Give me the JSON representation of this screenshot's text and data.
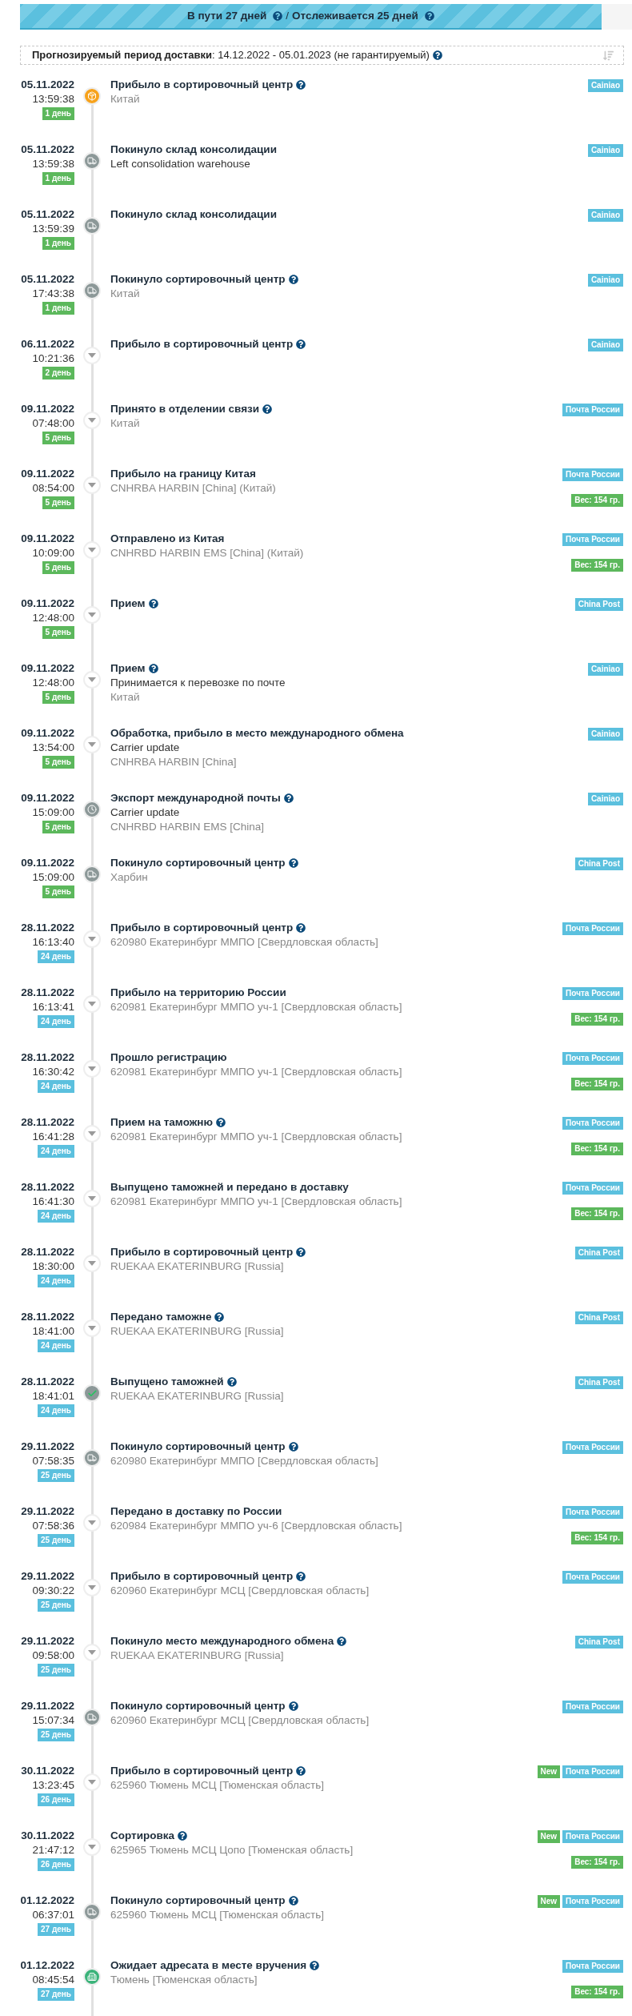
{
  "progress": {
    "level": 0.95,
    "in_transit": "В пути 27 дней",
    "separator": "/",
    "tracked": "Отслеживается 25 дней"
  },
  "forecast": {
    "text": "**Прогнозируемый период доставки**: 14.12.2022 - 05.01.2023 (не гарантируемый)"
  },
  "events": [
    {
      "date": "05.11.2022",
      "time": "13:59:38",
      "days": {
        "text": "1 день",
        "color": "#5cb85c"
      },
      "kind": "box",
      "title": "Прибыло в сортировочный центр",
      "help": true,
      "lines": [
        {
          "text": "Китай",
          "kind": "place"
        }
      ],
      "tags": [
        {
          "text": "Cainiao",
          "color": "#5bc0de"
        }
      ]
    },
    {
      "date": "05.11.2022",
      "time": "13:59:38",
      "days": {
        "text": "1 день",
        "color": "#5cb85c"
      },
      "kind": "truck",
      "title": "Покинуло склад консолидации",
      "help": false,
      "lines": [
        {
          "text": "Left consolidation warehouse",
          "kind": "note"
        }
      ],
      "tags": [
        {
          "text": "Cainiao",
          "color": "#5bc0de"
        }
      ]
    },
    {
      "date": "05.11.2022",
      "time": "13:59:39",
      "days": {
        "text": "1 день",
        "color": "#5cb85c"
      },
      "kind": "truck",
      "title": "Покинуло склад консолидации",
      "help": false,
      "tags": [
        {
          "text": "Cainiao",
          "color": "#5bc0de"
        }
      ]
    },
    {
      "date": "05.11.2022",
      "time": "17:43:38",
      "days": {
        "text": "1 день",
        "color": "#5cb85c"
      },
      "kind": "truck",
      "title": "Покинуло сортировочный центр",
      "help": true,
      "lines": [
        {
          "text": "Китай",
          "kind": "place"
        }
      ],
      "tags": [
        {
          "text": "Cainiao",
          "color": "#5bc0de"
        }
      ]
    },
    {
      "date": "06.11.2022",
      "time": "10:21:36",
      "days": {
        "text": "2 день",
        "color": "#5cb85c"
      },
      "kind": "arrow",
      "title": "Прибыло в сортировочный центр",
      "help": true,
      "tags": [
        {
          "text": "Cainiao",
          "color": "#5bc0de"
        }
      ]
    },
    {
      "date": "09.11.2022",
      "time": "07:48:00",
      "days": {
        "text": "5 день",
        "color": "#5cb85c"
      },
      "kind": "arrow",
      "title": "Принято в отделении связи",
      "help": true,
      "lines": [
        {
          "text": "Китай",
          "kind": "place"
        }
      ],
      "tags": [
        {
          "text": "Почта России",
          "color": "#5bc0de"
        }
      ]
    },
    {
      "date": "09.11.2022",
      "time": "08:54:00",
      "days": {
        "text": "5 день",
        "color": "#5cb85c"
      },
      "kind": "arrow",
      "title": "Прибыло на границу Китая",
      "help": false,
      "lines": [
        {
          "text": "CNHRBA HARBIN [China] (Китай)",
          "kind": "place"
        }
      ],
      "tags": [
        {
          "text": "Почта России",
          "color": "#5bc0de"
        }
      ],
      "weight": "Вес: 154 гр."
    },
    {
      "date": "09.11.2022",
      "time": "10:09:00",
      "days": {
        "text": "5 день",
        "color": "#5cb85c"
      },
      "kind": "arrow",
      "title": "Отправлено из Китая",
      "help": false,
      "lines": [
        {
          "text": "CNHRBD HARBIN EMS [China] (Китай)",
          "kind": "place"
        }
      ],
      "tags": [
        {
          "text": "Почта России",
          "color": "#5bc0de"
        }
      ],
      "weight": "Вес: 154 гр."
    },
    {
      "date": "09.11.2022",
      "time": "12:48:00",
      "days": {
        "text": "5 день",
        "color": "#5cb85c"
      },
      "kind": "arrow",
      "title": "Прием",
      "help": true,
      "tags": [
        {
          "text": "China Post",
          "color": "#5bc0de"
        }
      ]
    },
    {
      "date": "09.11.2022",
      "time": "12:48:00",
      "days": {
        "text": "5 день",
        "color": "#5cb85c"
      },
      "kind": "arrow",
      "title": "Прием",
      "help": true,
      "lines": [
        {
          "text": "Принимается к перевозке по почте",
          "kind": "note"
        },
        {
          "text": "Китай",
          "kind": "place"
        }
      ],
      "tags": [
        {
          "text": "Cainiao",
          "color": "#5bc0de"
        }
      ]
    },
    {
      "date": "09.11.2022",
      "time": "13:54:00",
      "days": {
        "text": "5 день",
        "color": "#5cb85c"
      },
      "kind": "arrow",
      "title": "Обработка, прибыло в место международного обмена",
      "help": false,
      "lines": [
        {
          "text": "Carrier update",
          "kind": "note"
        },
        {
          "text": "CNHRBA HARBIN [China]",
          "kind": "place"
        }
      ],
      "tags": [
        {
          "text": "Cainiao",
          "color": "#5bc0de"
        }
      ]
    },
    {
      "date": "09.11.2022",
      "time": "15:09:00",
      "days": {
        "text": "5 день",
        "color": "#5cb85c"
      },
      "kind": "clock",
      "title": "Экспорт международной почты",
      "help": true,
      "lines": [
        {
          "text": "Carrier update",
          "kind": "note"
        },
        {
          "text": "CNHRBD HARBIN EMS [China]",
          "kind": "place"
        }
      ],
      "tags": [
        {
          "text": "Cainiao",
          "color": "#5bc0de"
        }
      ]
    },
    {
      "date": "09.11.2022",
      "time": "15:09:00",
      "days": {
        "text": "5 день",
        "color": "#5cb85c"
      },
      "kind": "truck",
      "title": "Покинуло сортировочный центр",
      "help": true,
      "lines": [
        {
          "text": "Харбин",
          "kind": "place"
        }
      ],
      "tags": [
        {
          "text": "China Post",
          "color": "#5bc0de"
        }
      ]
    },
    {
      "date": "28.11.2022",
      "time": "16:13:40",
      "days": {
        "text": "24 день",
        "color": "#5bc0de"
      },
      "kind": "arrow",
      "title": "Прибыло в сортировочный центр",
      "help": true,
      "lines": [
        {
          "text": "620980 Екатеринбург ММПО [Свердловская область]",
          "kind": "place"
        }
      ],
      "tags": [
        {
          "text": "Почта России",
          "color": "#5bc0de"
        }
      ]
    },
    {
      "date": "28.11.2022",
      "time": "16:13:41",
      "days": {
        "text": "24 день",
        "color": "#5bc0de"
      },
      "kind": "arrow",
      "title": "Прибыло на территорию России",
      "help": false,
      "lines": [
        {
          "text": "620981 Екатеринбург ММПО уч-1 [Свердловская область]",
          "kind": "place"
        }
      ],
      "tags": [
        {
          "text": "Почта России",
          "color": "#5bc0de"
        }
      ],
      "weight": "Вес: 154 гр."
    },
    {
      "date": "28.11.2022",
      "time": "16:30:42",
      "days": {
        "text": "24 день",
        "color": "#5bc0de"
      },
      "kind": "arrow",
      "title": "Прошло регистрацию",
      "help": false,
      "lines": [
        {
          "text": "620981 Екатеринбург ММПО уч-1 [Свердловская область]",
          "kind": "place"
        }
      ],
      "tags": [
        {
          "text": "Почта России",
          "color": "#5bc0de"
        }
      ],
      "weight": "Вес: 154 гр."
    },
    {
      "date": "28.11.2022",
      "time": "16:41:28",
      "days": {
        "text": "24 день",
        "color": "#5bc0de"
      },
      "kind": "arrow",
      "title": "Прием на таможню",
      "help": true,
      "lines": [
        {
          "text": "620981 Екатеринбург ММПО уч-1 [Свердловская область]",
          "kind": "place"
        }
      ],
      "tags": [
        {
          "text": "Почта России",
          "color": "#5bc0de"
        }
      ],
      "weight": "Вес: 154 гр."
    },
    {
      "date": "28.11.2022",
      "time": "16:41:30",
      "days": {
        "text": "24 день",
        "color": "#5bc0de"
      },
      "kind": "arrow",
      "title": "Выпущено таможней и передано в доставку",
      "help": false,
      "lines": [
        {
          "text": "620981 Екатеринбург ММПО уч-1 [Свердловская область]",
          "kind": "place"
        }
      ],
      "tags": [
        {
          "text": "Почта России",
          "color": "#5bc0de"
        }
      ],
      "weight": "Вес: 154 гр."
    },
    {
      "date": "28.11.2022",
      "time": "18:30:00",
      "days": {
        "text": "24 день",
        "color": "#5bc0de"
      },
      "kind": "arrow",
      "title": "Прибыло в сортировочный центр",
      "help": true,
      "lines": [
        {
          "text": "RUEKAA EKATERINBURG [Russia]",
          "kind": "place"
        }
      ],
      "tags": [
        {
          "text": "China Post",
          "color": "#5bc0de"
        }
      ]
    },
    {
      "date": "28.11.2022",
      "time": "18:41:00",
      "days": {
        "text": "24 день",
        "color": "#5bc0de"
      },
      "kind": "arrow",
      "title": "Передано таможне",
      "help": true,
      "lines": [
        {
          "text": "RUEKAA EKATERINBURG [Russia]",
          "kind": "place"
        }
      ],
      "tags": [
        {
          "text": "China Post",
          "color": "#5bc0de"
        }
      ]
    },
    {
      "date": "28.11.2022",
      "time": "18:41:01",
      "days": {
        "text": "24 день",
        "color": "#5bc0de"
      },
      "kind": "check",
      "title": "Выпущено таможней",
      "help": true,
      "lines": [
        {
          "text": "RUEKAA EKATERINBURG [Russia]",
          "kind": "place"
        }
      ],
      "tags": [
        {
          "text": "China Post",
          "color": "#5bc0de"
        }
      ]
    },
    {
      "date": "29.11.2022",
      "time": "07:58:35",
      "days": {
        "text": "25 день",
        "color": "#5bc0de"
      },
      "kind": "truck",
      "title": "Покинуло сортировочный центр",
      "help": true,
      "lines": [
        {
          "text": "620980 Екатеринбург ММПО [Свердловская область]",
          "kind": "place"
        }
      ],
      "tags": [
        {
          "text": "Почта России",
          "color": "#5bc0de"
        }
      ]
    },
    {
      "date": "29.11.2022",
      "time": "07:58:36",
      "days": {
        "text": "25 день",
        "color": "#5bc0de"
      },
      "kind": "arrow",
      "title": "Передано в доставку по России",
      "help": false,
      "lines": [
        {
          "text": "620984 Екатеринбург ММПО уч-6 [Свердловская область]",
          "kind": "place"
        }
      ],
      "tags": [
        {
          "text": "Почта России",
          "color": "#5bc0de"
        }
      ],
      "weight": "Вес: 154 гр."
    },
    {
      "date": "29.11.2022",
      "time": "09:30:22",
      "days": {
        "text": "25 день",
        "color": "#5bc0de"
      },
      "kind": "arrow",
      "title": "Прибыло в сортировочный центр",
      "help": true,
      "lines": [
        {
          "text": "620960 Екатеринбург МСЦ [Свердловская область]",
          "kind": "place"
        }
      ],
      "tags": [
        {
          "text": "Почта России",
          "color": "#5bc0de"
        }
      ]
    },
    {
      "date": "29.11.2022",
      "time": "09:58:00",
      "days": {
        "text": "25 день",
        "color": "#5bc0de"
      },
      "kind": "arrow",
      "title": "Покинуло место международного обмена",
      "help": true,
      "lines": [
        {
          "text": "RUEKAA EKATERINBURG [Russia]",
          "kind": "place"
        }
      ],
      "tags": [
        {
          "text": "China Post",
          "color": "#5bc0de"
        }
      ]
    },
    {
      "date": "29.11.2022",
      "time": "15:07:34",
      "days": {
        "text": "25 день",
        "color": "#5bc0de"
      },
      "kind": "truck",
      "title": "Покинуло сортировочный центр",
      "help": true,
      "lines": [
        {
          "text": "620960 Екатеринбург МСЦ [Свердловская область]",
          "kind": "place"
        }
      ],
      "tags": [
        {
          "text": "Почта России",
          "color": "#5bc0de"
        }
      ]
    },
    {
      "date": "30.11.2022",
      "time": "13:23:45",
      "days": {
        "text": "26 день",
        "color": "#5bc0de"
      },
      "kind": "arrow",
      "title": "Прибыло в сортировочный центр",
      "help": true,
      "lines": [
        {
          "text": "625960 Тюмень МСЦ [Тюменская область]",
          "kind": "place"
        }
      ],
      "tags": [
        {
          "text": "New",
          "color": "#5cb85c"
        },
        {
          "text": "Почта России",
          "color": "#5bc0de"
        }
      ]
    },
    {
      "date": "30.11.2022",
      "time": "21:47:12",
      "days": {
        "text": "26 день",
        "color": "#5bc0de"
      },
      "kind": "arrow",
      "title": "Сортировка",
      "help": true,
      "lines": [
        {
          "text": "625965 Тюмень МСЦ Цопо [Тюменская область]",
          "kind": "place"
        }
      ],
      "tags": [
        {
          "text": "New",
          "color": "#5cb85c"
        },
        {
          "text": "Почта России",
          "color": "#5bc0de"
        }
      ],
      "weight": "Вес: 154 гр."
    },
    {
      "date": "01.12.2022",
      "time": "06:37:01",
      "days": {
        "text": "27 день",
        "color": "#5bc0de"
      },
      "kind": "truck",
      "title": "Покинуло сортировочный центр",
      "help": true,
      "lines": [
        {
          "text": "625960 Тюмень МСЦ [Тюменская область]",
          "kind": "place"
        }
      ],
      "tags": [
        {
          "text": "New",
          "color": "#5cb85c"
        },
        {
          "text": "Почта России",
          "color": "#5bc0de"
        }
      ]
    },
    {
      "date": "01.12.2022",
      "time": "08:45:54",
      "days": {
        "text": "27 день",
        "color": "#5bc0de"
      },
      "kind": "building",
      "title": "Ожидает адресата в месте вручения",
      "help": true,
      "lines": [
        {
          "text": "Тюмень [Тюменская область]",
          "kind": "place"
        }
      ],
      "tags": [
        {
          "text": "Почта России",
          "color": "#5bc0de"
        }
      ],
      "weight": "Вес: 154 гр."
    }
  ]
}
